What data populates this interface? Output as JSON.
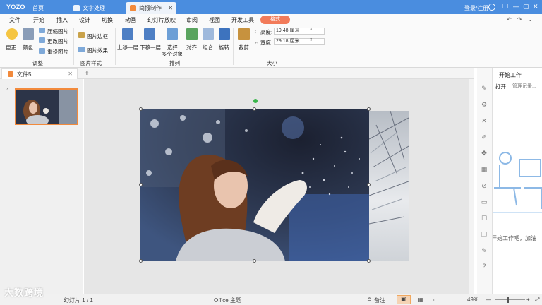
{
  "titlebar": {
    "logo": "YOZO",
    "home": "首页",
    "tabs": [
      {
        "label": "文字处理",
        "active": false
      },
      {
        "label": "简报制作",
        "active": true
      }
    ],
    "login": "登录/注册",
    "window_buttons": {
      "restore": "❐",
      "minimize": "—",
      "maximize": "▢",
      "close": "✕"
    }
  },
  "menu": {
    "items": [
      "文件",
      "开始",
      "插入",
      "设计",
      "切换",
      "动画",
      "幻灯片放映",
      "审阅",
      "视图",
      "开发工具"
    ],
    "format": "格式"
  },
  "ribbon": {
    "adjust": {
      "correct": "更正",
      "color": "颜色",
      "compress": "压缩图片",
      "change": "更改图片",
      "reset": "重设图片",
      "group": "调整"
    },
    "style": {
      "border": "图片边框",
      "effect": "图片效果",
      "group": "图片样式"
    },
    "arrange": {
      "up": "上移一层",
      "down": "下移一层",
      "select": "选择",
      "select2": "多个对象",
      "align": "对齐",
      "combine": "组合",
      "rotate": "旋转",
      "group": "排列"
    },
    "size": {
      "crop": "裁剪",
      "height_label": "高度:",
      "height_value": "19.48 厘米",
      "width_label": "宽度:",
      "width_value": "29.18 厘米",
      "group": "大小"
    }
  },
  "doc": {
    "tab": "文件5",
    "plus": "+"
  },
  "slides": {
    "number": "1"
  },
  "taskpane": {
    "title": "开始工作",
    "open": "打开",
    "manage": "管理记录...",
    "hint": "开始工作吧，加油"
  },
  "status": {
    "slide": "幻灯片 1 / 1",
    "theme": "Office 主题",
    "notes": "备注",
    "zoom": "49%"
  },
  "watermark": "大数跨境",
  "colors": {
    "titlebar": "#4a8ddf",
    "accent": "#f28a3c",
    "format_pill": "#f27b5a",
    "rotate_handle": "#39b54a"
  }
}
